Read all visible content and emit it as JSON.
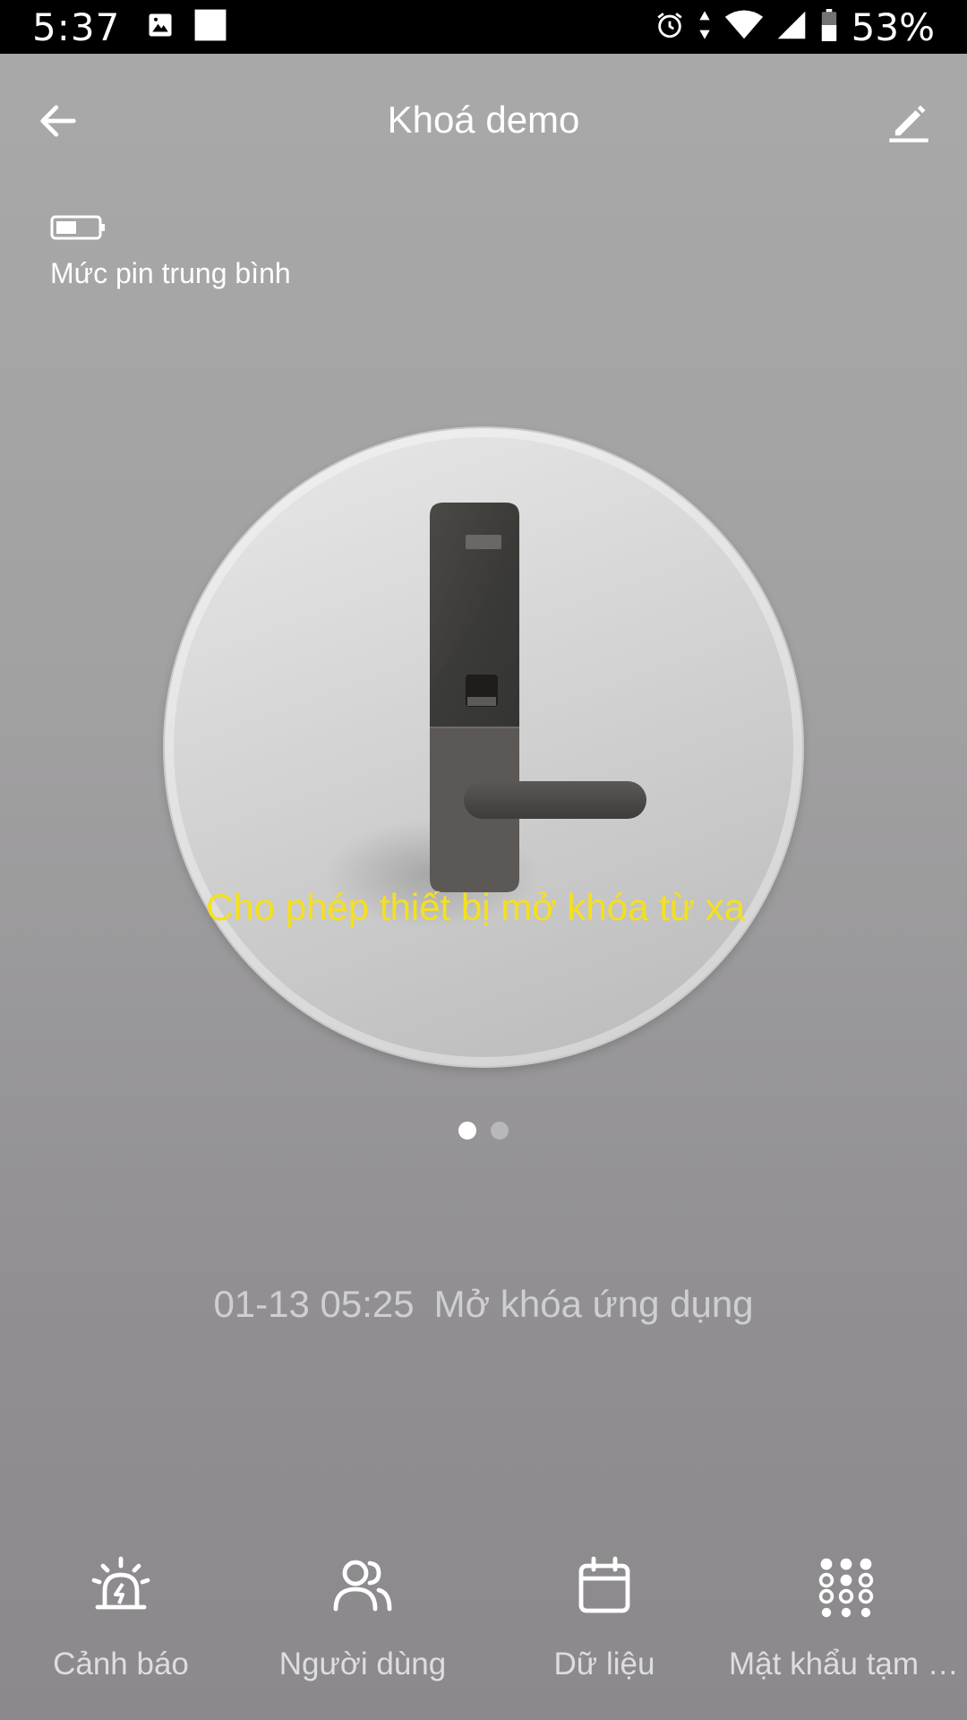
{
  "status_bar": {
    "time": "5:37",
    "battery_percent": "53%",
    "icons": [
      "image-icon",
      "square-icon",
      "alarm-icon",
      "data-arrows-icon",
      "wifi-icon",
      "signal-icon",
      "battery-icon"
    ]
  },
  "header": {
    "title": "Khoá demo",
    "back_icon": "arrow-left-icon",
    "edit_icon": "pencil-icon"
  },
  "battery_status": {
    "label": "Mức pin trung bình",
    "icon": "battery-medium-icon"
  },
  "lock_panel": {
    "message": "Cho phép thiết bị mở khóa từ xa",
    "pages": 2,
    "active_page": 1
  },
  "last_event": {
    "time": "01-13 05:25",
    "description": "Mở khóa ứng dụng"
  },
  "bottom_nav": {
    "items": [
      {
        "label": "Cảnh báo",
        "icon": "alarm-light-icon"
      },
      {
        "label": "Người dùng",
        "icon": "users-icon"
      },
      {
        "label": "Dữ liệu",
        "icon": "calendar-icon"
      },
      {
        "label": "Mật khẩu tạm thời",
        "icon": "keypad-icon"
      }
    ]
  },
  "colors": {
    "message": "#f4e01f",
    "status_bar_bg": "#000000",
    "text_primary": "#ffffff",
    "text_muted": "#cfcfd1"
  }
}
